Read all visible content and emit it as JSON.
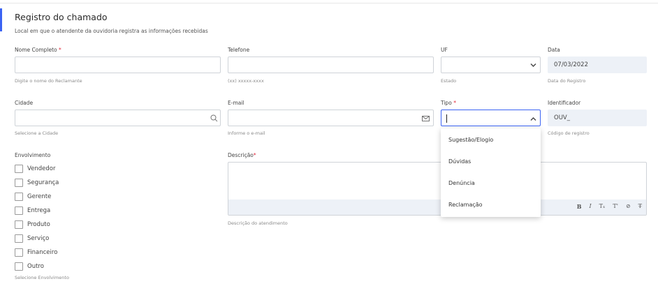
{
  "header": {
    "title": "Registro do chamado",
    "subtitle": "Local em que o atendente da ouvidoria registra as informações recebidas"
  },
  "fields": {
    "nome": {
      "label": "Nome Completo",
      "required_mark": "*",
      "value": "",
      "help": "Digite o nome do Reclamante"
    },
    "telefone": {
      "label": "Telefone",
      "value": "",
      "help": "(xx) xxxxx-xxxx"
    },
    "uf": {
      "label": "UF",
      "value": "",
      "help": "Estado"
    },
    "data": {
      "label": "Data",
      "value": "07/03/2022",
      "help": "Data do Registro"
    },
    "cidade": {
      "label": "Cidade",
      "value": "",
      "help": "Selecione a Cidade"
    },
    "email": {
      "label": "E-mail",
      "value": "",
      "help": "Informe o e-mail"
    },
    "tipo": {
      "label": "Tipo",
      "required_mark": "*",
      "value": ""
    },
    "identificador": {
      "label": "Identificador",
      "value": "OUV_",
      "help": "Código de registro"
    },
    "envolvimento": {
      "label": "Envolvimento",
      "help": "Selecione Envolvimento",
      "options": [
        "Vendedor",
        "Segurança",
        "Gerente",
        "Entrega",
        "Produto",
        "Serviço",
        "Financeiro",
        "Outro"
      ]
    },
    "descricao": {
      "label": "Descrição",
      "required_mark": "*",
      "help": "Descrição do atendimento"
    }
  },
  "tipo_dropdown": {
    "options": [
      "Sugestão/Elogio",
      "Dúvidas",
      "Denúncia",
      "Reclamação"
    ]
  },
  "editor_toolbar": {
    "bold": "B",
    "italic": "I",
    "clear_format": "Tₓ",
    "superscript": "T'",
    "link": "⊘",
    "strikethrough": "T̶"
  },
  "icons": {
    "uf_chevron": "chevron-down-icon",
    "tipo_chevron": "chevron-up-icon",
    "cidade_search": "search-icon",
    "email": "envelope-icon"
  },
  "colors": {
    "accent": "#3b63f3",
    "required": "#e0283a",
    "readonly_bg": "#edf1f7"
  }
}
